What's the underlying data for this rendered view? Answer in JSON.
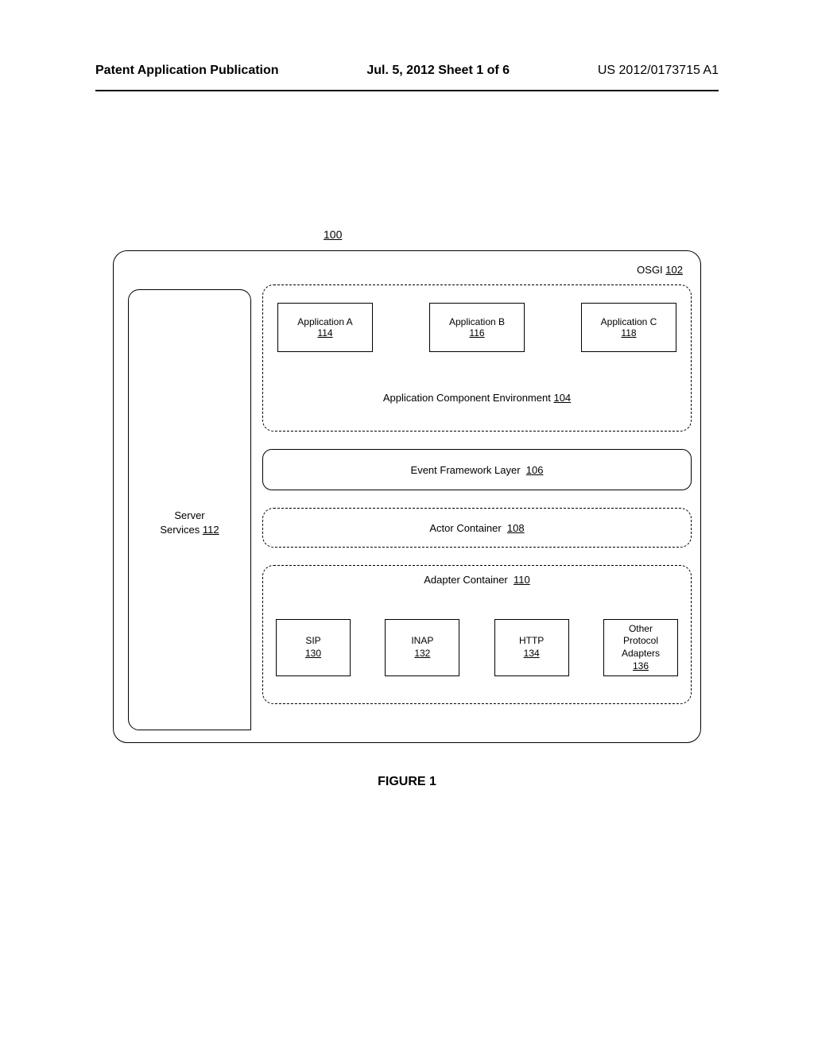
{
  "header": {
    "left": "Patent Application Publication",
    "center": "Jul. 5, 2012  Sheet 1 of 6",
    "right": "US 2012/0173715 A1"
  },
  "refs": {
    "r100": "100"
  },
  "osgi": {
    "label": "OSGI",
    "num": "102"
  },
  "server_services": {
    "label1": "Server",
    "label2": "Services",
    "num": "112"
  },
  "apps": {
    "a": {
      "label": "Application A",
      "num": "114"
    },
    "b": {
      "label": "Application B",
      "num": "116"
    },
    "c": {
      "label": "Application C",
      "num": "118"
    }
  },
  "app_env": {
    "label": "Application Component Environment",
    "num": "104"
  },
  "event_framework": {
    "label": "Event Framework Layer",
    "num": "106"
  },
  "actor_container": {
    "label": "Actor Container",
    "num": "108"
  },
  "adapter_container": {
    "label": "Adapter Container",
    "num": "110"
  },
  "adapters": {
    "sip": {
      "label": "SIP",
      "num": "130"
    },
    "inap": {
      "label": "INAP",
      "num": "132"
    },
    "http": {
      "label": "HTTP",
      "num": "134"
    },
    "other": {
      "label1": "Other",
      "label2": "Protocol",
      "label3": "Adapters",
      "num": "136"
    }
  },
  "caption": "FIGURE 1"
}
